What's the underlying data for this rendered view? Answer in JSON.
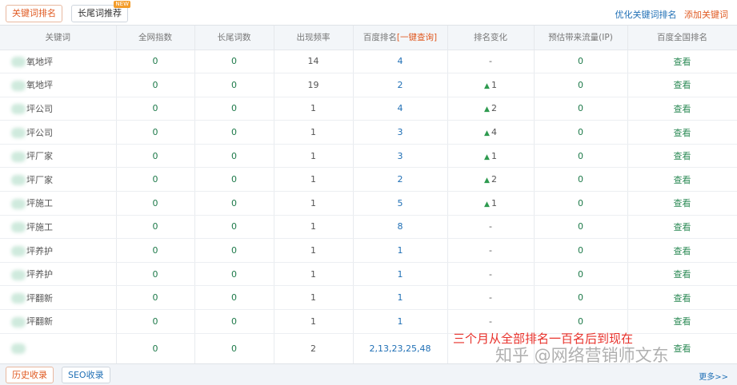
{
  "tabs": {
    "keyword_rank": "关键词排名",
    "longtail": "长尾词推荐",
    "new_badge": "NEW"
  },
  "top_links": {
    "optimize": "优化关键词排名",
    "add": "添加关键词"
  },
  "columns": [
    "关键词",
    "全网指数",
    "长尾词数",
    "出现频率",
    "百度排名",
    "[一键查询]",
    "排名变化",
    "预估带来流量(IP)",
    "百度全国排名"
  ],
  "rows": [
    {
      "keyword": "氧地坪",
      "index": "0",
      "longtail": "0",
      "freq": "14",
      "rank": "4",
      "change": "-",
      "change_up": false,
      "traffic": "0",
      "view": "查看"
    },
    {
      "keyword": "氧地坪",
      "index": "0",
      "longtail": "0",
      "freq": "19",
      "rank": "2",
      "change": "1",
      "change_up": true,
      "traffic": "0",
      "view": "查看"
    },
    {
      "keyword": "坪公司",
      "index": "0",
      "longtail": "0",
      "freq": "1",
      "rank": "4",
      "change": "2",
      "change_up": true,
      "traffic": "0",
      "view": "查看"
    },
    {
      "keyword": "坪公司",
      "index": "0",
      "longtail": "0",
      "freq": "1",
      "rank": "3",
      "change": "4",
      "change_up": true,
      "traffic": "0",
      "view": "查看"
    },
    {
      "keyword": "坪厂家",
      "index": "0",
      "longtail": "0",
      "freq": "1",
      "rank": "3",
      "change": "1",
      "change_up": true,
      "traffic": "0",
      "view": "查看"
    },
    {
      "keyword": "坪厂家",
      "index": "0",
      "longtail": "0",
      "freq": "1",
      "rank": "2",
      "change": "2",
      "change_up": true,
      "traffic": "0",
      "view": "查看"
    },
    {
      "keyword": "坪施工",
      "index": "0",
      "longtail": "0",
      "freq": "1",
      "rank": "5",
      "change": "1",
      "change_up": true,
      "traffic": "0",
      "view": "查看"
    },
    {
      "keyword": "坪施工",
      "index": "0",
      "longtail": "0",
      "freq": "1",
      "rank": "8",
      "change": "-",
      "change_up": false,
      "traffic": "0",
      "view": "查看"
    },
    {
      "keyword": "坪养护",
      "index": "0",
      "longtail": "0",
      "freq": "1",
      "rank": "1",
      "change": "-",
      "change_up": false,
      "traffic": "0",
      "view": "查看"
    },
    {
      "keyword": "坪养护",
      "index": "0",
      "longtail": "0",
      "freq": "1",
      "rank": "1",
      "change": "-",
      "change_up": false,
      "traffic": "0",
      "view": "查看"
    },
    {
      "keyword": "坪翻新",
      "index": "0",
      "longtail": "0",
      "freq": "1",
      "rank": "1",
      "change": "-",
      "change_up": false,
      "traffic": "0",
      "view": "查看"
    },
    {
      "keyword": "坪翻新",
      "index": "0",
      "longtail": "0",
      "freq": "1",
      "rank": "1",
      "change": "-",
      "change_up": false,
      "traffic": "0",
      "view": "查看"
    },
    {
      "keyword": "",
      "index": "0",
      "longtail": "0",
      "freq": "2",
      "rank": "2,13,23,25,48",
      "change": "",
      "change_up": false,
      "traffic": "",
      "view": "查看"
    }
  ],
  "overlay_text": "三个月从全部排名一百名后到现在",
  "watermark": "知乎 @网络营销师文东",
  "bottom": {
    "history": "历史收录",
    "seo": "SEO收录",
    "more": "更多>>"
  },
  "colors": {
    "accent_orange": "#e05a22",
    "link_blue": "#1f6fb5",
    "value_green": "#1e7a4a",
    "overlay_red": "#e8302a"
  }
}
